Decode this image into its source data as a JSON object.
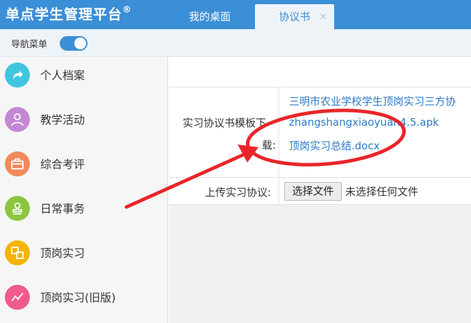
{
  "header": {
    "app_title": "单点学生管理平台",
    "registered_mark": "®",
    "tabs": [
      {
        "label": "我的桌面"
      },
      {
        "label": "协议书",
        "close": "×"
      }
    ]
  },
  "navbar": {
    "label": "导航菜单",
    "toggle_on": true
  },
  "sidebar": {
    "items": [
      {
        "label": "个人档案",
        "icon": "share-arrow-icon",
        "color": "#3fc6de"
      },
      {
        "label": "教学活动",
        "icon": "person-icon",
        "color": "#c488d3"
      },
      {
        "label": "综合考评",
        "icon": "briefcase-icon",
        "color": "#f08a5d"
      },
      {
        "label": "日常事务",
        "icon": "stamp-icon",
        "color": "#8cc63f"
      },
      {
        "label": "顶岗实习",
        "icon": "transfer-icon",
        "color": "#f5b400"
      },
      {
        "label": "顶岗实习(旧版)",
        "icon": "trend-line-icon",
        "color": "#f05a8c"
      }
    ]
  },
  "form": {
    "template_label_line1": "实习协议书模板下",
    "template_label_line2": "载:",
    "links": [
      "三明市农业学校学生顶岗实习三方协",
      "zhangshangxiaoyuan4.5.apk",
      "顶岗实习总结.docx"
    ],
    "upload_label": "上传实习协议:",
    "choose_button": "选择文件",
    "no_file_text": "未选择任何文件"
  },
  "annotation": {
    "color": "#e8262a",
    "shapes": [
      "red-ellipse",
      "red-arrow"
    ]
  }
}
